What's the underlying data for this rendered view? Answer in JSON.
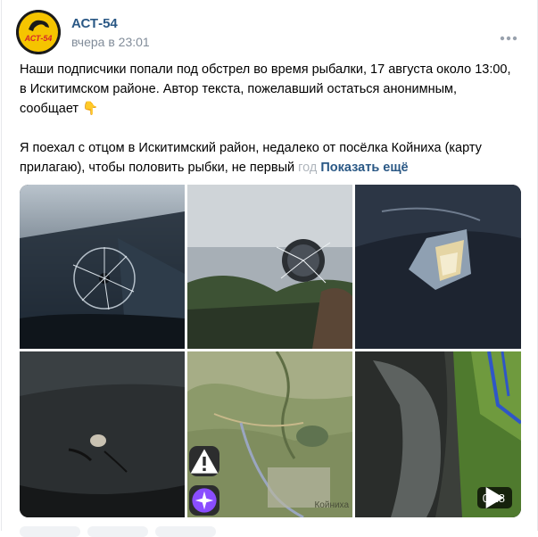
{
  "post": {
    "author": "АСТ-54",
    "logo_text": "АСТ-54",
    "time": "вчера в 23:01",
    "paragraph1": "Наши подписчики попали под обстрел во время рыбалки, 17 августа около 13:00, в Искитимском районе. Автор текста, пожелавший остаться анонимным, сообщает",
    "emoji": "👇",
    "paragraph2": "Я поехал с отцом в Искитимский район, недалеко от посёлка Койниха (карту прилагаю), чтобы половить рыбки, не первый",
    "paragraph2_fade": "год",
    "show_more": "Показать ещё"
  },
  "media": {
    "map_place_label": "Койниха",
    "video_duration": "0:18"
  },
  "colors": {
    "link": "#2a5885",
    "muted": "#818c99",
    "logo_yellow": "#f5c400"
  }
}
